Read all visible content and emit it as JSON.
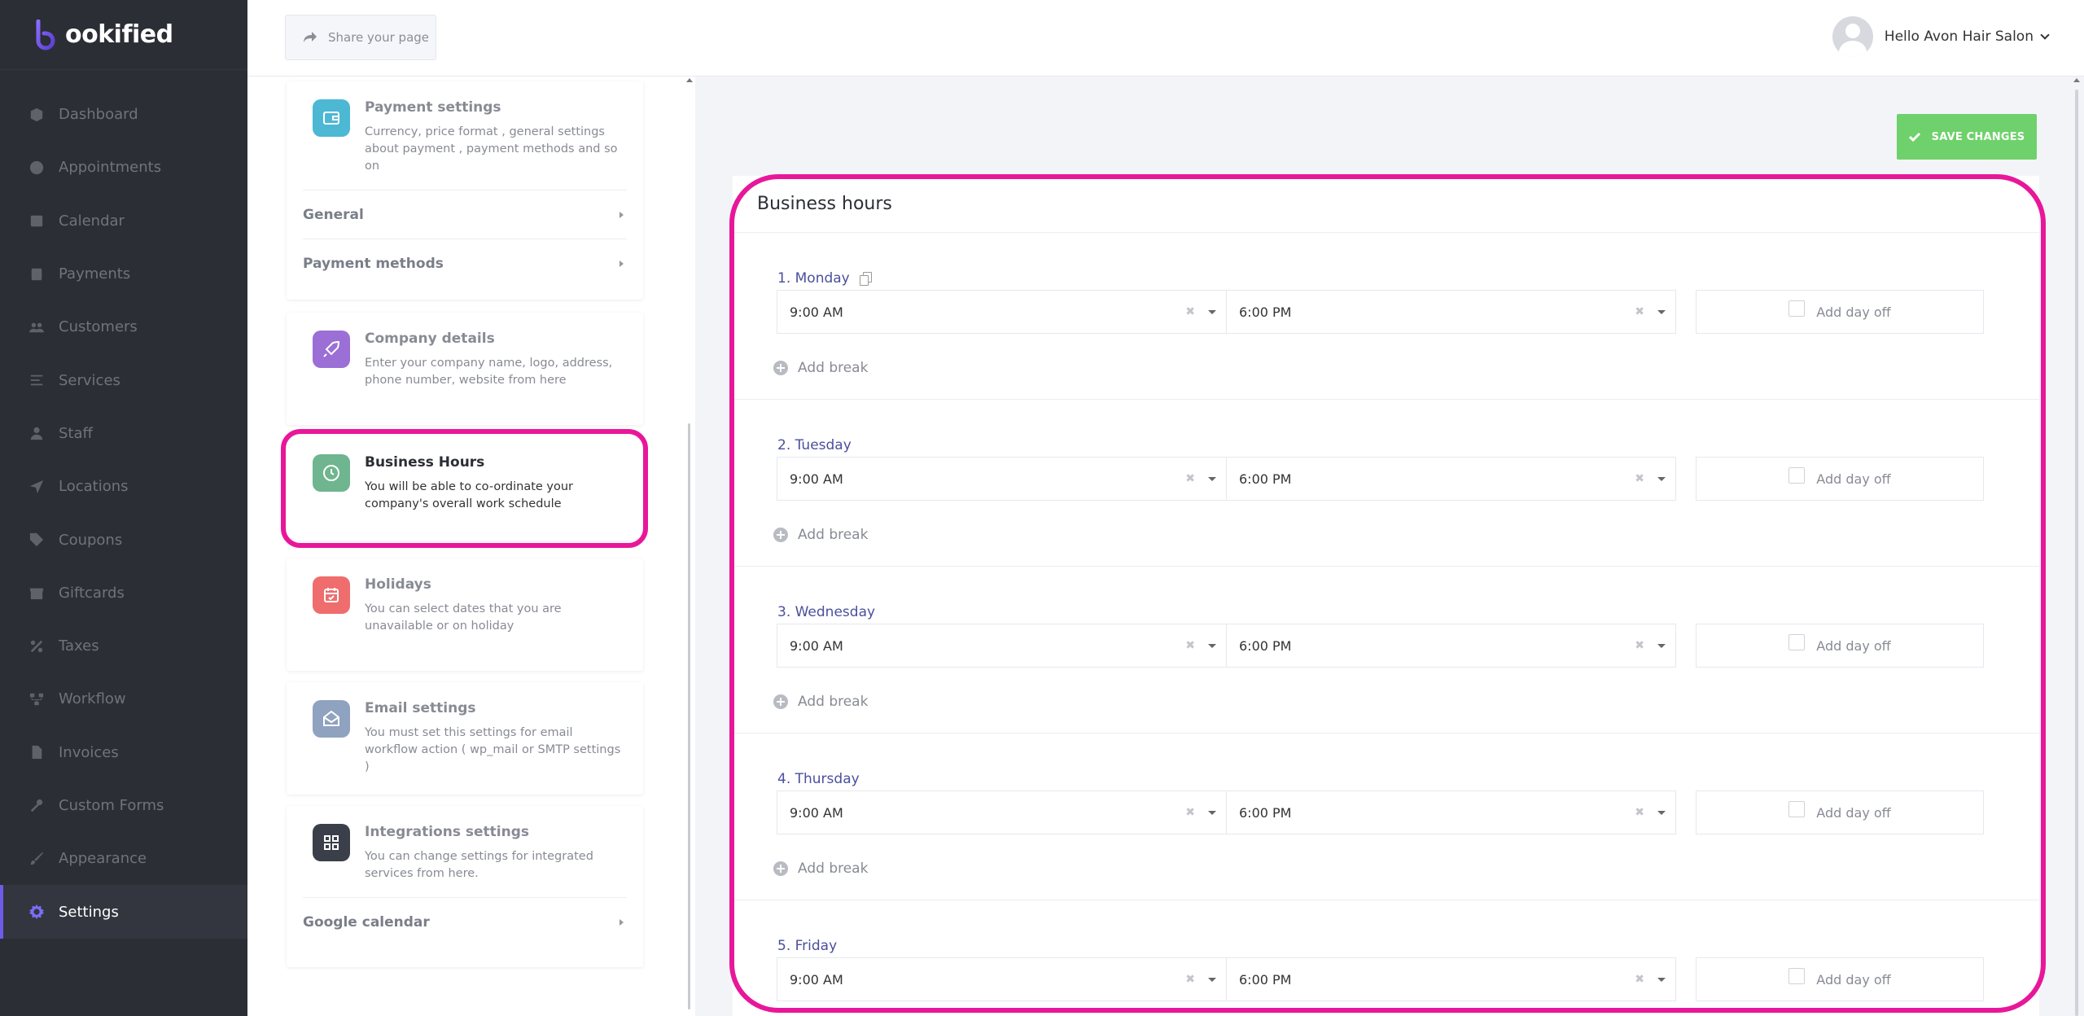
{
  "app": {
    "logo_text": "ookified"
  },
  "sidebar": {
    "items": [
      {
        "label": "Dashboard",
        "icon": "cube-icon"
      },
      {
        "label": "Appointments",
        "icon": "clock-icon"
      },
      {
        "label": "Calendar",
        "icon": "calendar-icon"
      },
      {
        "label": "Payments",
        "icon": "card-icon"
      },
      {
        "label": "Customers",
        "icon": "users-icon"
      },
      {
        "label": "Services",
        "icon": "list-icon"
      },
      {
        "label": "Staff",
        "icon": "user-icon"
      },
      {
        "label": "Locations",
        "icon": "location-arrow-icon"
      },
      {
        "label": "Coupons",
        "icon": "tag-icon"
      },
      {
        "label": "Giftcards",
        "icon": "gift-icon"
      },
      {
        "label": "Taxes",
        "icon": "percent-icon"
      },
      {
        "label": "Workflow",
        "icon": "workflow-icon"
      },
      {
        "label": "Invoices",
        "icon": "file-icon"
      },
      {
        "label": "Custom Forms",
        "icon": "tools-icon"
      },
      {
        "label": "Appearance",
        "icon": "brush-icon"
      },
      {
        "label": "Settings",
        "icon": "gear-icon",
        "active": true
      }
    ]
  },
  "topbar": {
    "share_label": "Share your page",
    "user_greeting": "Hello Avon Hair Salon"
  },
  "settings_cards": {
    "payment": {
      "title": "Payment settings",
      "desc": "Currency, price format , general settings about payment , payment methods and so on",
      "links": [
        "General",
        "Payment methods"
      ],
      "color": "#4cb8d4"
    },
    "company": {
      "title": "Company details",
      "desc": "Enter your company name, logo, address, phone number, website from here",
      "color": "#9b6fd6"
    },
    "business_hours": {
      "title": "Business Hours",
      "desc": "You will be able to co-ordinate your company's overall work schedule",
      "color": "#6fb58f"
    },
    "holidays": {
      "title": "Holidays",
      "desc": "You can select dates that you are unavailable or on holiday",
      "color": "#ef6d6d"
    },
    "email": {
      "title": "Email settings",
      "desc": "You must set this settings for email workflow action ( wp_mail or SMTP settings )",
      "color": "#8fa2bf"
    },
    "integrations": {
      "title": "Integrations settings",
      "desc": "You can change settings for integrated services from here.",
      "links": [
        "Google calendar"
      ],
      "color": "#3a3f4a"
    }
  },
  "main": {
    "save_label": "SAVE CHANGES",
    "panel_title": "Business hours",
    "add_break_label": "Add break",
    "day_off_label": "Add day off",
    "days": [
      {
        "label": "1. Monday",
        "start": "9:00 AM",
        "end": "6:00 PM"
      },
      {
        "label": "2. Tuesday",
        "start": "9:00 AM",
        "end": "6:00 PM"
      },
      {
        "label": "3. Wednesday",
        "start": "9:00 AM",
        "end": "6:00 PM"
      },
      {
        "label": "4. Thursday",
        "start": "9:00 AM",
        "end": "6:00 PM"
      },
      {
        "label": "5. Friday",
        "start": "9:00 AM",
        "end": "6:00 PM"
      }
    ]
  },
  "colors": {
    "highlight": "#e8179a",
    "save_button": "#6fd16b",
    "accent": "#6c5ce7"
  }
}
